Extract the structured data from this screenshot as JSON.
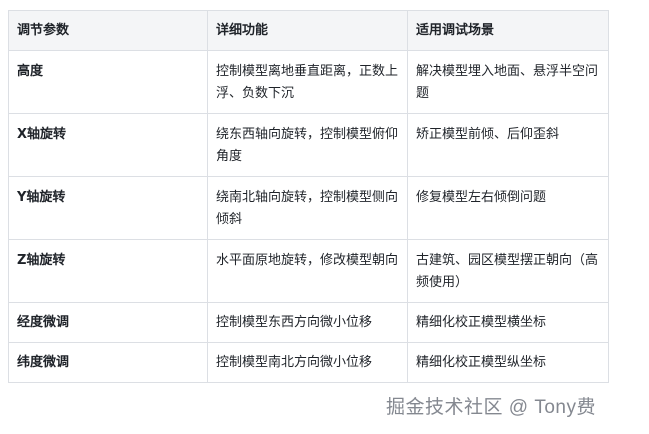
{
  "table": {
    "headers": [
      "调节参数",
      "详细功能",
      "适用调试场景"
    ],
    "rows": [
      {
        "param": "高度",
        "function": "控制模型离地垂直距离，正数上浮、负数下沉",
        "scenario": "解决模型埋入地面、悬浮半空问题"
      },
      {
        "param": "X轴旋转",
        "function": "绕东西轴向旋转，控制模型俯仰角度",
        "scenario": "矫正模型前倾、后仰歪斜"
      },
      {
        "param": "Y轴旋转",
        "function": "绕南北轴向旋转，控制模型侧向倾斜",
        "scenario": "修复模型左右倾倒问题"
      },
      {
        "param": "Z轴旋转",
        "function": "水平面原地旋转，修改模型朝向",
        "scenario": "古建筑、园区模型摆正朝向（高频使用）"
      },
      {
        "param": "经度微调",
        "function": "控制模型东西方向微小位移",
        "scenario": "精细化校正模型横坐标"
      },
      {
        "param": "纬度微调",
        "function": "控制模型南北方向微小位移",
        "scenario": "精细化校正模型纵坐标"
      }
    ]
  },
  "watermark": "掘金技术社区 @ Tony费"
}
